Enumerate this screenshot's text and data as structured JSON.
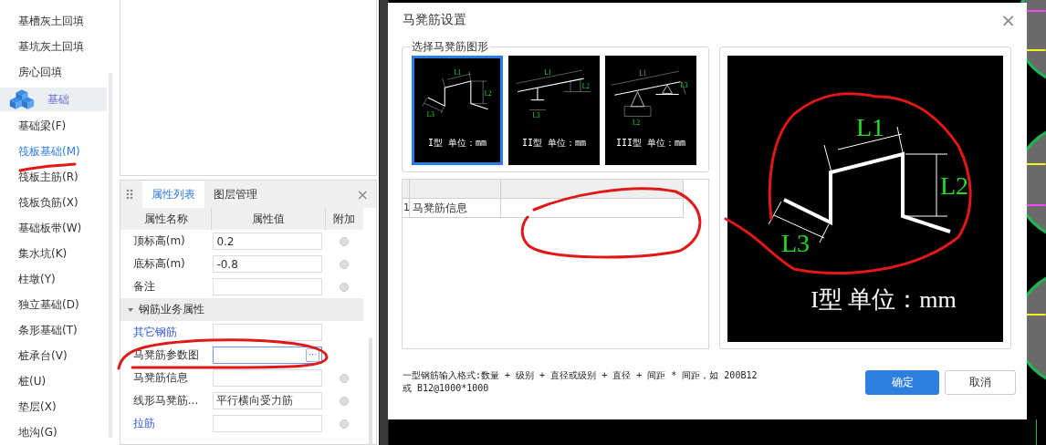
{
  "sidebar": {
    "items": [
      {
        "kind": "item",
        "label": "基槽灰土回填",
        "selected": false
      },
      {
        "kind": "item",
        "label": "基坑灰土回填",
        "selected": false
      },
      {
        "kind": "item",
        "label": "房心回填",
        "selected": false
      },
      {
        "kind": "category",
        "label": "基础",
        "selected": false
      },
      {
        "kind": "item",
        "label": "基础梁(F)",
        "selected": false
      },
      {
        "kind": "item",
        "label": "筏板基础(M)",
        "selected": true
      },
      {
        "kind": "item",
        "label": "筏板主筋(R)",
        "selected": false
      },
      {
        "kind": "item",
        "label": "筏板负筋(X)",
        "selected": false
      },
      {
        "kind": "item",
        "label": "基础板带(W)",
        "selected": false
      },
      {
        "kind": "item",
        "label": "集水坑(K)",
        "selected": false
      },
      {
        "kind": "item",
        "label": "柱墩(Y)",
        "selected": false
      },
      {
        "kind": "item",
        "label": "独立基础(D)",
        "selected": false
      },
      {
        "kind": "item",
        "label": "条形基础(T)",
        "selected": false
      },
      {
        "kind": "item",
        "label": "桩承台(V)",
        "selected": false
      },
      {
        "kind": "item",
        "label": "桩(U)",
        "selected": false
      },
      {
        "kind": "item",
        "label": "垫层(X)",
        "selected": false
      },
      {
        "kind": "item",
        "label": "地沟(G)",
        "selected": false
      }
    ]
  },
  "properties": {
    "tabs": [
      {
        "label": "属性列表",
        "selected": true
      },
      {
        "label": "图层管理",
        "selected": false
      }
    ],
    "close": "×",
    "columns": [
      "属性名称",
      "属性值",
      "附加"
    ],
    "rows": [
      {
        "kind": "row",
        "name": "顶标高(m)",
        "value": "0.2",
        "link": false,
        "focused": false,
        "option": true
      },
      {
        "kind": "row",
        "name": "底标高(m)",
        "value": "-0.8",
        "link": false,
        "focused": false,
        "option": true
      },
      {
        "kind": "row",
        "name": "备注",
        "value": "",
        "link": false,
        "focused": false,
        "option": true
      },
      {
        "kind": "group",
        "name": "钢筋业务属性",
        "expanded": true
      },
      {
        "kind": "row",
        "name": "其它钢筋",
        "value": "",
        "link": true,
        "focused": false,
        "option": false
      },
      {
        "kind": "row",
        "name": "马凳筋参数图",
        "value": "",
        "link": false,
        "focused": true,
        "option": false,
        "button": "···"
      },
      {
        "kind": "row",
        "name": "马凳筋信息",
        "value": "",
        "link": false,
        "focused": false,
        "option": true
      },
      {
        "kind": "row",
        "name": "线形马凳筋...",
        "value": "平行横向受力筋",
        "link": false,
        "focused": false,
        "option": true
      },
      {
        "kind": "row",
        "name": "拉筋",
        "value": "",
        "link": true,
        "focused": false,
        "option": true
      }
    ]
  },
  "dialog": {
    "title": "马凳筋设置",
    "close": "×",
    "shape_group": {
      "legend": "选择马凳筋图形",
      "shapes": [
        {
          "kind": "zigzag",
          "caption": "I型 单位：mm",
          "labels": [
            "L1",
            "L2",
            "L3"
          ],
          "selected": true
        },
        {
          "kind": "leg",
          "caption": "II型 单位：mm",
          "labels": [
            "L1",
            "L2",
            "L3"
          ],
          "selected": false
        },
        {
          "kind": "tripod",
          "caption": "III型 单位：mm",
          "labels": [
            "L1",
            "L2",
            "L3"
          ],
          "selected": false
        }
      ]
    },
    "table": {
      "rows": [
        {
          "number": "1",
          "name": "马凳筋信息",
          "value": ""
        }
      ]
    },
    "preview": {
      "kind": "zigzag",
      "caption": "I型 单位：mm",
      "labels": [
        "L1",
        "L2",
        "L3"
      ]
    },
    "hint": [
      "一型钢筋输入格式:数量 + 级别 + 直径或级别 + 直径 + 间距 * 间距，如 200B12",
      "或 B12@1000*1000"
    ],
    "buttons": [
      {
        "label": "确定",
        "kind": "primary"
      },
      {
        "label": "取消",
        "kind": "secondary"
      }
    ]
  }
}
